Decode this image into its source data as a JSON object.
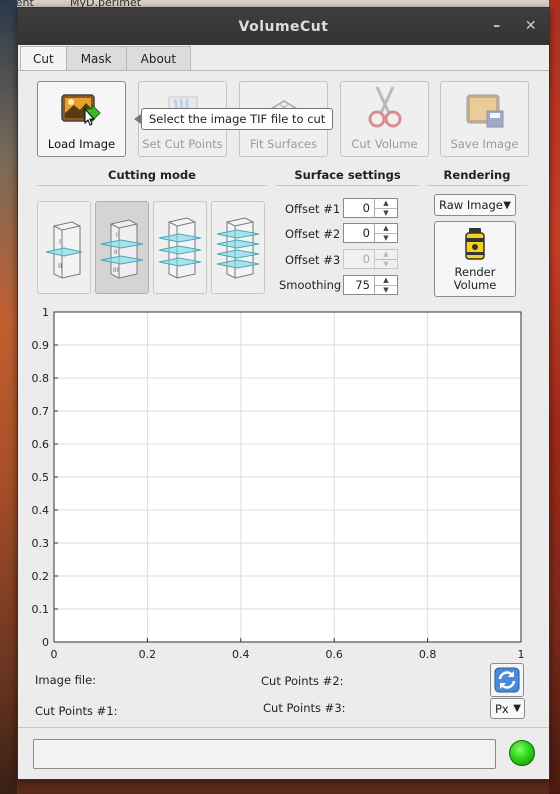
{
  "app": {
    "title": "VolumeCut"
  },
  "desktop": {
    "top_text_1": "iment",
    "top_text_2": "MyD.perlmet"
  },
  "tabs": [
    {
      "label": "Cut",
      "active": true
    },
    {
      "label": "Mask",
      "active": false
    },
    {
      "label": "About",
      "active": false
    }
  ],
  "toolbar": {
    "load_image": "Load Image",
    "set_cut_points": "Set Cut Points",
    "fit_surfaces": "Fit Surfaces",
    "cut_volume": "Cut Volume",
    "save_image": "Save Image",
    "tooltip": "Select the image TIF file to cut"
  },
  "sections": {
    "cutting_mode": "Cutting mode",
    "surface_settings": "Surface settings",
    "rendering": "Rendering"
  },
  "surface": {
    "offset1_label": "Offset #1",
    "offset1_value": "0",
    "offset2_label": "Offset #2",
    "offset2_value": "0",
    "offset3_label": "Offset #3",
    "offset3_value": "0",
    "smoothing_label": "Smoothing",
    "smoothing_value": "75"
  },
  "rendering": {
    "mode_selected": "Raw Image",
    "render_line1": "Render",
    "render_line2": "Volume"
  },
  "chart_data": {
    "type": "line",
    "series": [],
    "xlim": [
      0,
      1
    ],
    "ylim": [
      0,
      1
    ],
    "x_ticks": [
      "0",
      "0.2",
      "0.4",
      "0.6",
      "0.8",
      "1"
    ],
    "y_ticks": [
      "0",
      "0.1",
      "0.2",
      "0.3",
      "0.4",
      "0.5",
      "0.6",
      "0.7",
      "0.8",
      "0.9",
      "1"
    ],
    "grid": true
  },
  "info": {
    "image_file": "Image file:",
    "cut_points_1": "Cut Points #1:",
    "cut_points_2": "Cut Points #2:",
    "cut_points_3": "Cut Points #3:",
    "unit_selected": "Px"
  },
  "status": {
    "text": ""
  },
  "colors": {
    "status_led": "#2ed41a",
    "plane": "#7fd8e6"
  }
}
